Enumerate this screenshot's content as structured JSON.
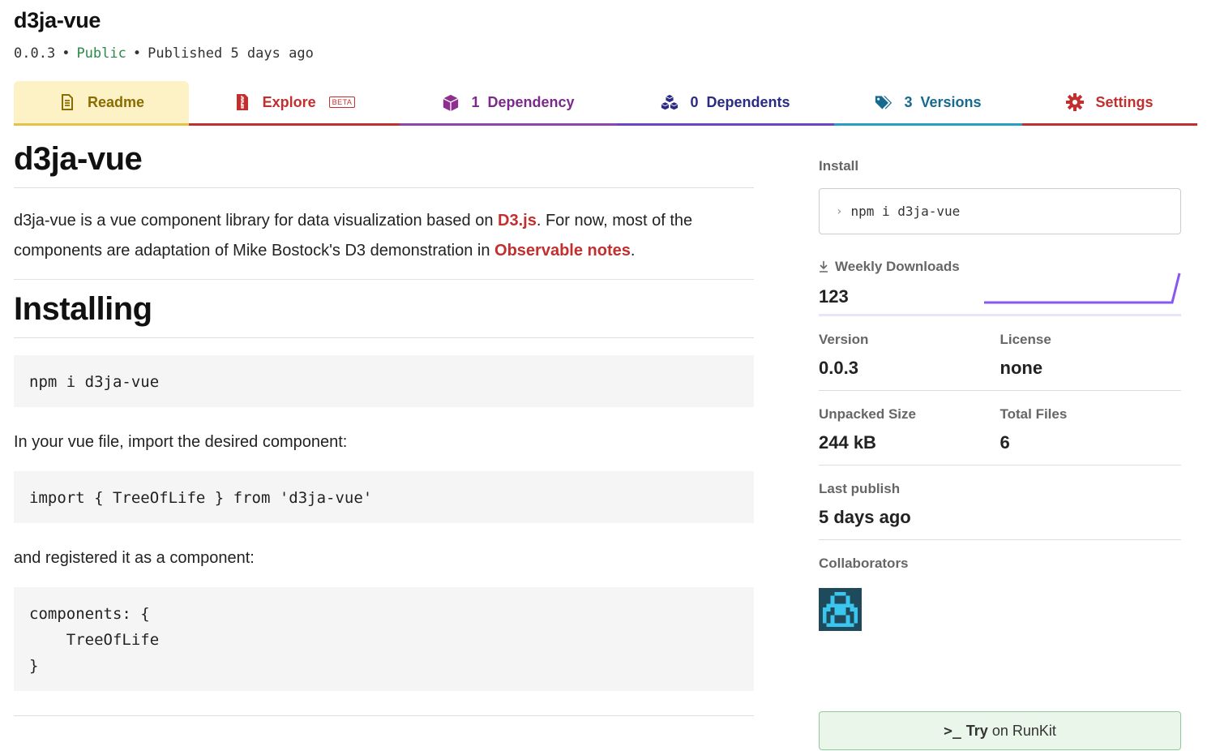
{
  "header": {
    "package_name": "d3ja-vue",
    "version": "0.0.3",
    "visibility": "Public",
    "published": "Published 5 days ago",
    "separator": "•"
  },
  "tabs": {
    "readme": "Readme",
    "explore": "Explore",
    "explore_badge": "BETA",
    "dependency_count": "1",
    "dependency": "Dependency",
    "dependents_count": "0",
    "dependents": "Dependents",
    "versions_count": "3",
    "versions": "Versions",
    "settings": "Settings"
  },
  "readme": {
    "title": "d3ja-vue",
    "intro_part1": "d3ja-vue is a vue component library for data visualization based on ",
    "intro_link1": "D3.js",
    "intro_part2": ". For now, most of the components are adaptation of Mike Bostock's D3 demonstration in ",
    "intro_link2": "Observable notes",
    "intro_part3": ".",
    "installing_heading": "Installing",
    "code_install": "npm i d3ja-vue",
    "para_import": "In your vue file, import the desired component:",
    "code_import": "import { TreeOfLife } from 'd3ja-vue'",
    "para_register": "and registered it as a component:",
    "code_register": "components: {\n    TreeOfLife\n}"
  },
  "sidebar": {
    "install_label": "Install",
    "install_prompt": "›",
    "install_cmd": "npm i d3ja-vue",
    "weekly_downloads_label": "Weekly Downloads",
    "weekly_downloads": "123",
    "version_label": "Version",
    "version": "0.0.3",
    "license_label": "License",
    "license": "none",
    "unpacked_size_label": "Unpacked Size",
    "unpacked_size": "244 kB",
    "total_files_label": "Total Files",
    "total_files": "6",
    "last_publish_label": "Last publish",
    "last_publish": "5 days ago",
    "collaborators_label": "Collaborators",
    "runkit_try": "Try",
    "runkit_rest": "on RunKit"
  },
  "colors": {
    "readme_tab": "#8a6d00",
    "explore_tab": "#c22f2f",
    "dependency_tab": "#7b2a8b",
    "dependents_tab": "#2b2b86",
    "versions_tab": "#176a8f",
    "settings_tab": "#c22f2f",
    "link": "#c22f2f",
    "public": "#2a8a4a",
    "sparkline": "#8956ef"
  }
}
